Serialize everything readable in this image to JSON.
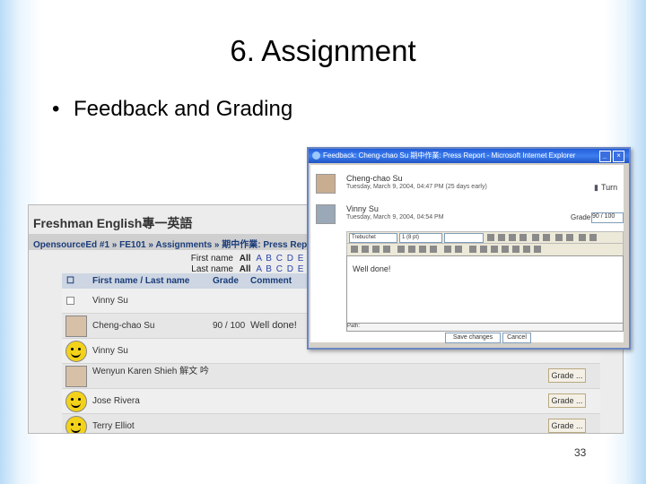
{
  "slide": {
    "title": "6. Assignment",
    "bullet": "Feedback and Grading",
    "page_number": "33"
  },
  "moodle": {
    "course_title": "Freshman English專一英語",
    "breadcrumb": "OpensourceEd #1 » FE101 » Assignments » 期中作業: Press Report",
    "filters": [
      {
        "label": "First name",
        "all": "All",
        "letters": "A B C D E F G"
      },
      {
        "label": "Last name",
        "all": "All",
        "letters": "A B C D E F G"
      }
    ],
    "columns": {
      "name": "First name / Last name",
      "grade": "Grade",
      "comment": "Comment"
    },
    "rows": [
      {
        "name": "Vinny Su",
        "grade": "",
        "comment": "",
        "button": "",
        "avatar": "checkbox"
      },
      {
        "name": "Cheng-chao Su",
        "grade": "90 / 100",
        "comment": "Well done!",
        "button": "",
        "avatar": "photo"
      },
      {
        "name": "Vinny Su",
        "grade": "",
        "comment": "",
        "button": "",
        "avatar": "smiley"
      },
      {
        "name": "Wenyun Karen Shieh 解文 吟",
        "grade": "",
        "comment": "",
        "button": "Grade ...",
        "avatar": "photo"
      },
      {
        "name": "Jose Rivera",
        "grade": "",
        "comment": "",
        "button": "Grade ...",
        "avatar": "smiley"
      },
      {
        "name": "Terry Elliot",
        "grade": "",
        "comment": "",
        "button": "Grade ...",
        "avatar": "smiley"
      }
    ]
  },
  "popup": {
    "window_title": "Feedback: Cheng-chao Su 期中作業: Press Report - Microsoft Internet Explorer",
    "submitter": {
      "name": "Cheng-chao Su",
      "date": "Tuesday, March 9, 2004, 04:47 PM (25 days early)"
    },
    "turn_in_label": "Turn",
    "teacher": {
      "name": "Vinny Su",
      "date": "Tuesday, March 9, 2004, 04:54 PM"
    },
    "grade_label": "Grade:",
    "grade_value": "90 / 100",
    "font_select": "Trebuchet",
    "size_select": "1 (8 pt)",
    "editor_text": "Well done!",
    "path_label": "Path:",
    "save_label": "Save changes",
    "cancel_label": "Cancel"
  }
}
